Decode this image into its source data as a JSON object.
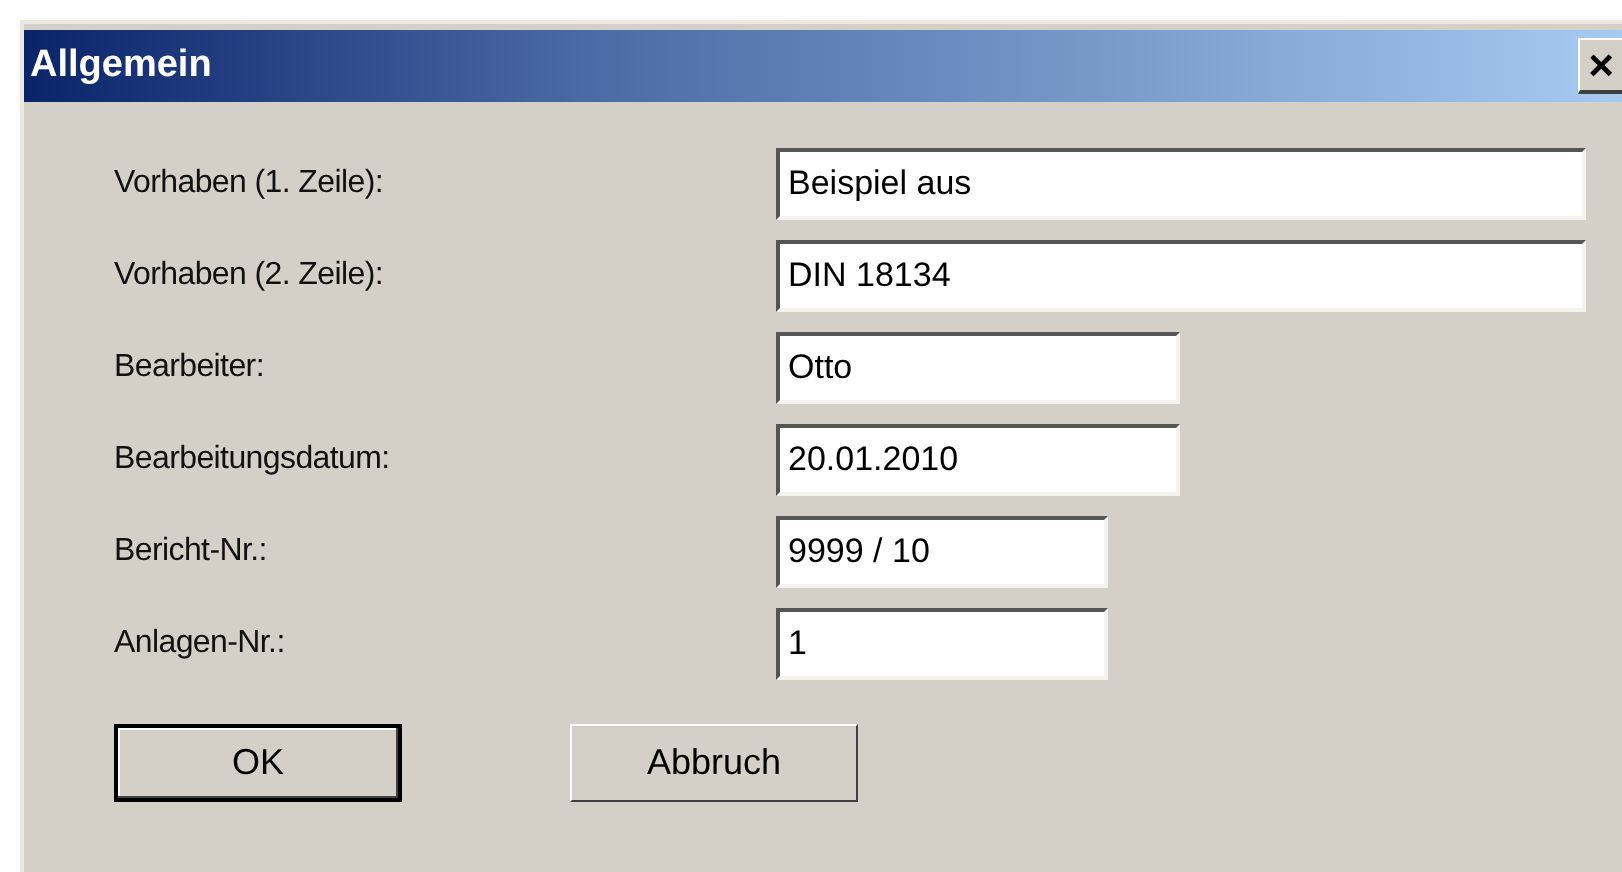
{
  "window": {
    "title": "Allgemein",
    "close": "×"
  },
  "fields": [
    {
      "label": "Vorhaben (1. Zeile):",
      "value": "Beispiel aus"
    },
    {
      "label": "Vorhaben (2. Zeile):",
      "value": "DIN 18134"
    },
    {
      "label": "Bearbeiter:",
      "value": "Otto"
    },
    {
      "label": "Bearbeitungsdatum:",
      "value": "20.01.2010"
    },
    {
      "label": "Bericht-Nr.:",
      "value": "9999 / 10"
    },
    {
      "label": "Anlagen-Nr.:",
      "value": "1"
    }
  ],
  "buttons": [
    {
      "label": "OK",
      "default": true
    },
    {
      "label": "Abbruch",
      "default": false
    }
  ]
}
